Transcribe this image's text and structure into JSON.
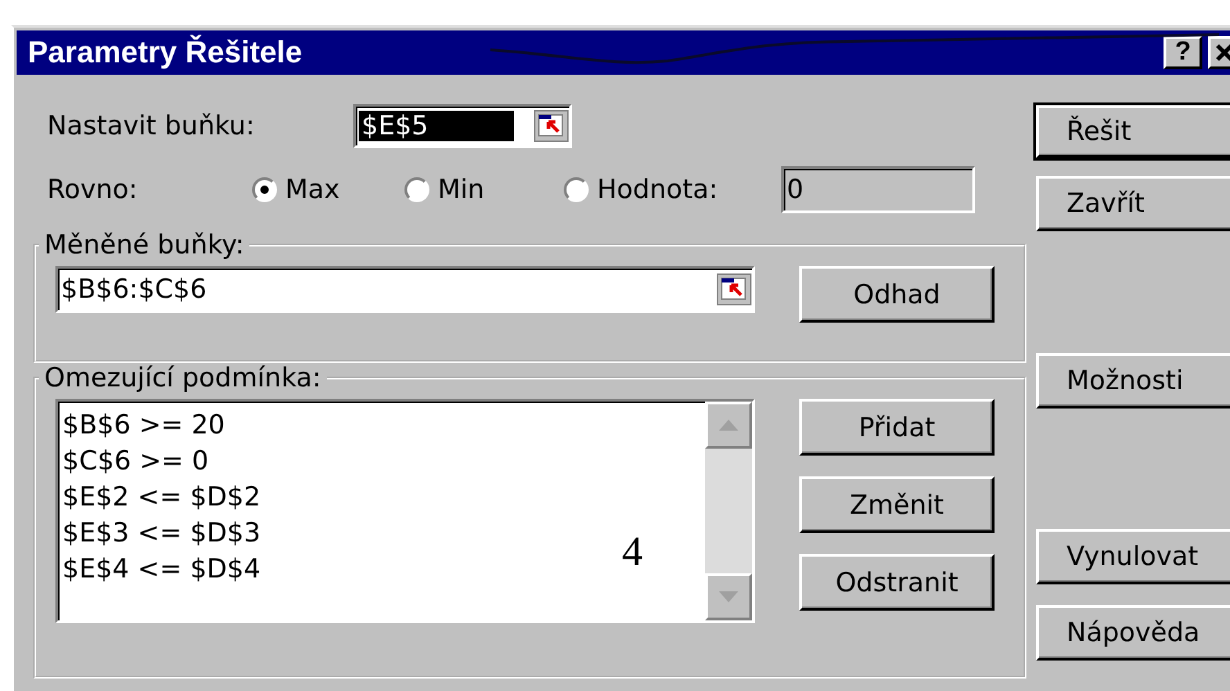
{
  "window": {
    "title": "Parametry Řešitele",
    "help_button": "?"
  },
  "target_cell": {
    "label": "Nastavit buňku:",
    "value": "$E$5",
    "selected": true
  },
  "equal_to": {
    "label": "Rovno:",
    "options": [
      {
        "label": "Max",
        "selected": true
      },
      {
        "label": "Min",
        "selected": false
      },
      {
        "label": "Hodnota:",
        "selected": false
      }
    ],
    "value": "0"
  },
  "changing_cells": {
    "label": "Měněné buňky:",
    "value": "$B$6:$C$6",
    "button": "Odhad"
  },
  "constraints": {
    "label": "Omezující podmínka:",
    "items": [
      "$B$6 >= 20",
      "$C$6 >= 0",
      "$E$2 <= $D$2",
      "$E$3 <= $D$3",
      "$E$4 <= $D$4"
    ],
    "buttons": [
      "Přidat",
      "Změnit",
      "Odstranit"
    ]
  },
  "side_buttons": [
    {
      "label": "Řešit",
      "default": true
    },
    {
      "label": "Zavřít",
      "default": false
    },
    {
      "label": "Možnosti",
      "default": false
    },
    {
      "label": "Vynulovat",
      "default": false
    },
    {
      "label": "Nápověda",
      "default": false
    }
  ],
  "annotation": "4"
}
